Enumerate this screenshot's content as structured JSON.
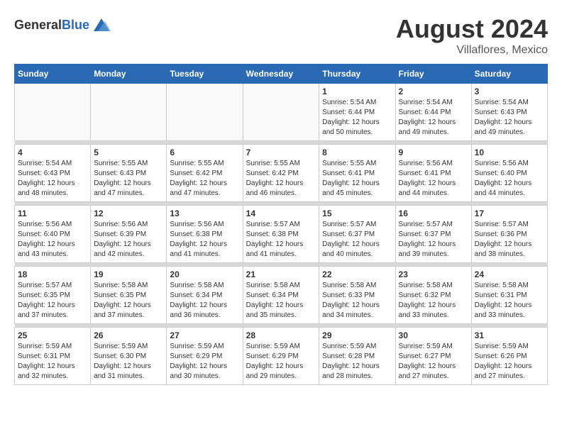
{
  "header": {
    "logo_general": "General",
    "logo_blue": "Blue",
    "month_year": "August 2024",
    "location": "Villaflores, Mexico"
  },
  "days_of_week": [
    "Sunday",
    "Monday",
    "Tuesday",
    "Wednesday",
    "Thursday",
    "Friday",
    "Saturday"
  ],
  "weeks": [
    [
      {
        "day": "",
        "info": ""
      },
      {
        "day": "",
        "info": ""
      },
      {
        "day": "",
        "info": ""
      },
      {
        "day": "",
        "info": ""
      },
      {
        "day": "1",
        "info": "Sunrise: 5:54 AM\nSunset: 6:44 PM\nDaylight: 12 hours\nand 50 minutes."
      },
      {
        "day": "2",
        "info": "Sunrise: 5:54 AM\nSunset: 6:44 PM\nDaylight: 12 hours\nand 49 minutes."
      },
      {
        "day": "3",
        "info": "Sunrise: 5:54 AM\nSunset: 6:43 PM\nDaylight: 12 hours\nand 49 minutes."
      }
    ],
    [
      {
        "day": "4",
        "info": "Sunrise: 5:54 AM\nSunset: 6:43 PM\nDaylight: 12 hours\nand 48 minutes."
      },
      {
        "day": "5",
        "info": "Sunrise: 5:55 AM\nSunset: 6:43 PM\nDaylight: 12 hours\nand 47 minutes."
      },
      {
        "day": "6",
        "info": "Sunrise: 5:55 AM\nSunset: 6:42 PM\nDaylight: 12 hours\nand 47 minutes."
      },
      {
        "day": "7",
        "info": "Sunrise: 5:55 AM\nSunset: 6:42 PM\nDaylight: 12 hours\nand 46 minutes."
      },
      {
        "day": "8",
        "info": "Sunrise: 5:55 AM\nSunset: 6:41 PM\nDaylight: 12 hours\nand 45 minutes."
      },
      {
        "day": "9",
        "info": "Sunrise: 5:56 AM\nSunset: 6:41 PM\nDaylight: 12 hours\nand 44 minutes."
      },
      {
        "day": "10",
        "info": "Sunrise: 5:56 AM\nSunset: 6:40 PM\nDaylight: 12 hours\nand 44 minutes."
      }
    ],
    [
      {
        "day": "11",
        "info": "Sunrise: 5:56 AM\nSunset: 6:40 PM\nDaylight: 12 hours\nand 43 minutes."
      },
      {
        "day": "12",
        "info": "Sunrise: 5:56 AM\nSunset: 6:39 PM\nDaylight: 12 hours\nand 42 minutes."
      },
      {
        "day": "13",
        "info": "Sunrise: 5:56 AM\nSunset: 6:38 PM\nDaylight: 12 hours\nand 41 minutes."
      },
      {
        "day": "14",
        "info": "Sunrise: 5:57 AM\nSunset: 6:38 PM\nDaylight: 12 hours\nand 41 minutes."
      },
      {
        "day": "15",
        "info": "Sunrise: 5:57 AM\nSunset: 6:37 PM\nDaylight: 12 hours\nand 40 minutes."
      },
      {
        "day": "16",
        "info": "Sunrise: 5:57 AM\nSunset: 6:37 PM\nDaylight: 12 hours\nand 39 minutes."
      },
      {
        "day": "17",
        "info": "Sunrise: 5:57 AM\nSunset: 6:36 PM\nDaylight: 12 hours\nand 38 minutes."
      }
    ],
    [
      {
        "day": "18",
        "info": "Sunrise: 5:57 AM\nSunset: 6:35 PM\nDaylight: 12 hours\nand 37 minutes."
      },
      {
        "day": "19",
        "info": "Sunrise: 5:58 AM\nSunset: 6:35 PM\nDaylight: 12 hours\nand 37 minutes."
      },
      {
        "day": "20",
        "info": "Sunrise: 5:58 AM\nSunset: 6:34 PM\nDaylight: 12 hours\nand 36 minutes."
      },
      {
        "day": "21",
        "info": "Sunrise: 5:58 AM\nSunset: 6:34 PM\nDaylight: 12 hours\nand 35 minutes."
      },
      {
        "day": "22",
        "info": "Sunrise: 5:58 AM\nSunset: 6:33 PM\nDaylight: 12 hours\nand 34 minutes."
      },
      {
        "day": "23",
        "info": "Sunrise: 5:58 AM\nSunset: 6:32 PM\nDaylight: 12 hours\nand 33 minutes."
      },
      {
        "day": "24",
        "info": "Sunrise: 5:58 AM\nSunset: 6:31 PM\nDaylight: 12 hours\nand 33 minutes."
      }
    ],
    [
      {
        "day": "25",
        "info": "Sunrise: 5:59 AM\nSunset: 6:31 PM\nDaylight: 12 hours\nand 32 minutes."
      },
      {
        "day": "26",
        "info": "Sunrise: 5:59 AM\nSunset: 6:30 PM\nDaylight: 12 hours\nand 31 minutes."
      },
      {
        "day": "27",
        "info": "Sunrise: 5:59 AM\nSunset: 6:29 PM\nDaylight: 12 hours\nand 30 minutes."
      },
      {
        "day": "28",
        "info": "Sunrise: 5:59 AM\nSunset: 6:29 PM\nDaylight: 12 hours\nand 29 minutes."
      },
      {
        "day": "29",
        "info": "Sunrise: 5:59 AM\nSunset: 6:28 PM\nDaylight: 12 hours\nand 28 minutes."
      },
      {
        "day": "30",
        "info": "Sunrise: 5:59 AM\nSunset: 6:27 PM\nDaylight: 12 hours\nand 27 minutes."
      },
      {
        "day": "31",
        "info": "Sunrise: 5:59 AM\nSunset: 6:26 PM\nDaylight: 12 hours\nand 27 minutes."
      }
    ]
  ]
}
